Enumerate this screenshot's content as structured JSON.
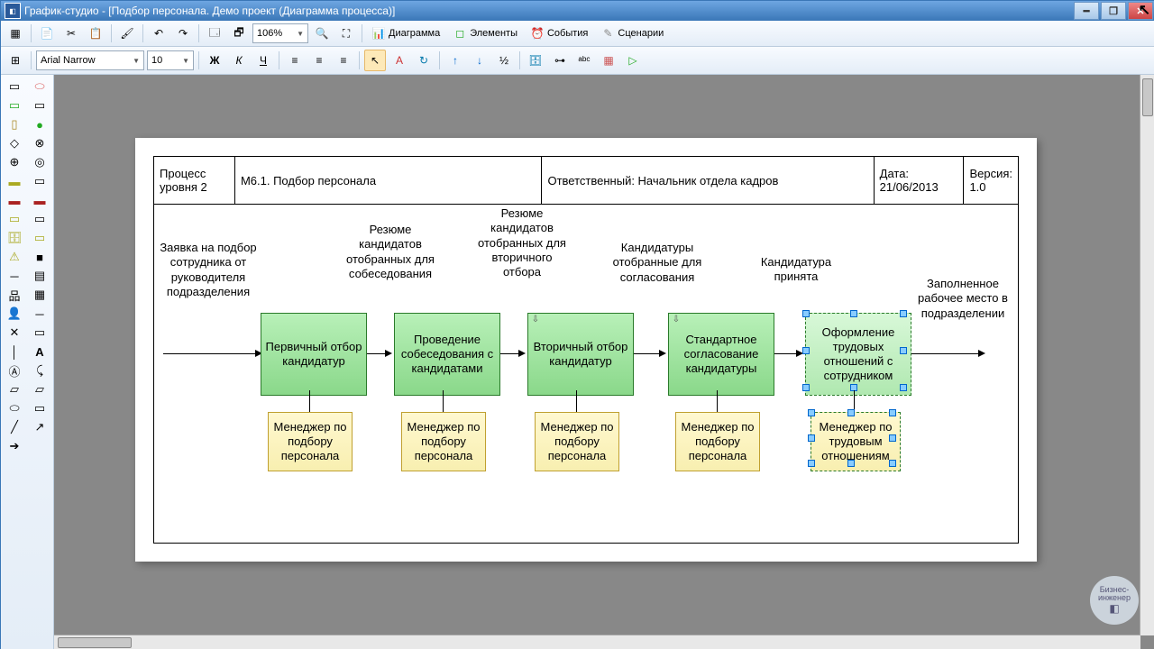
{
  "title": "График-студио - [Подбор персонала. Демо проект (Диаграмма процесса)]",
  "zoom": "106%",
  "menu": {
    "diagram": "Диаграмма",
    "elements": "Элементы",
    "events": "События",
    "scenarios": "Сценарии"
  },
  "font": {
    "name": "Arial Narrow",
    "size": "10"
  },
  "header": {
    "proc_lbl": "Процесс уровня 2",
    "proc_val": "М6.1.  Подбор персонала",
    "resp": "Ответственный: Начальник отдела кадров",
    "date_lbl": "Дата:",
    "date_val": "21/06/2013",
    "ver_lbl": "Версия:",
    "ver_val": "1.0"
  },
  "labels": {
    "start": "Заявка на подбор сотрудника от руководителя подразделения",
    "l1": "Резюме кандидатов отобранных для собеседования",
    "l2": "Резюме кандидатов отобранных для вторичного отбора",
    "l3": "Кандидатуры отобранные для согласования",
    "l4": "Кандидатура принята",
    "end": "Заполненное рабочее место в подразделении"
  },
  "boxes": {
    "b1": "Первичный отбор кандидатур",
    "b2": "Проведение собеседования с кандидатами",
    "b3": "Вторичный отбор кандидатур",
    "b4": "Стандартное согласование кандидатуры",
    "b5": "Оформление трудовых отношений с сотрудником",
    "r1": "Менеджер по подбору персонала",
    "r2": "Менеджер по подбору персонала",
    "r3": "Менеджер по подбору персонала",
    "r4": "Менеджер по подбору персонала",
    "r5": "Менеджер по трудовым отношениям"
  },
  "watermark": {
    "l1": "Бизнес-",
    "l2": "инженер"
  }
}
